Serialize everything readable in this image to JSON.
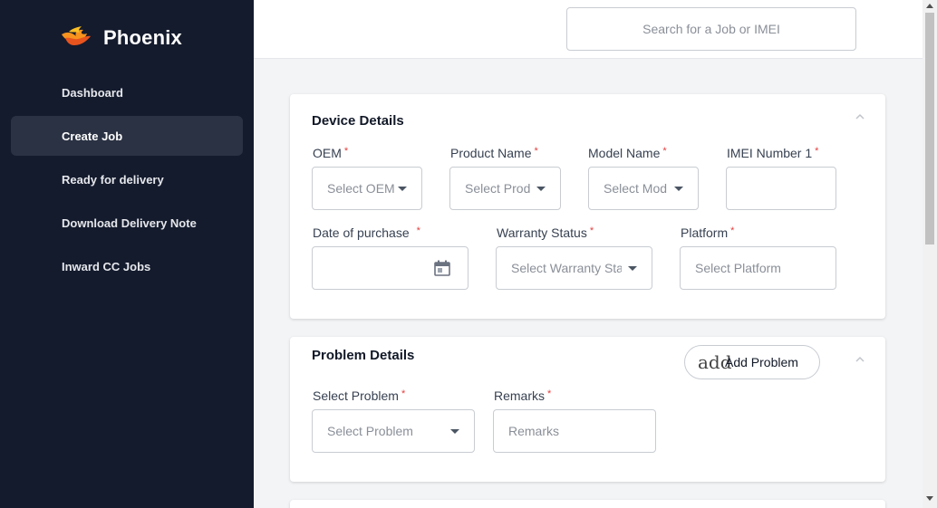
{
  "brand": {
    "name": "Phoenix"
  },
  "sidebar": {
    "items": [
      {
        "label": "Dashboard"
      },
      {
        "label": "Create Job"
      },
      {
        "label": "Ready for delivery"
      },
      {
        "label": "Download Delivery Note"
      },
      {
        "label": "Inward CC Jobs"
      }
    ],
    "active_index": 1
  },
  "header": {
    "search_placeholder": "Search for a Job or IMEI"
  },
  "device_details": {
    "title": "Device Details",
    "required_mark": "*",
    "fields": {
      "oem": {
        "label": "OEM",
        "placeholder": "Select OEM"
      },
      "product_name": {
        "label": "Product Name",
        "placeholder": "Select Prod"
      },
      "model_name": {
        "label": "Model Name",
        "placeholder": "Select Mod"
      },
      "imei": {
        "label": "IMEI Number 1",
        "value": ""
      },
      "date_of_purchase": {
        "label": "Date of purchase",
        "value": ""
      },
      "warranty_status": {
        "label": "Warranty Status",
        "placeholder": "Select Warranty Stat"
      },
      "platform": {
        "label": "Platform",
        "placeholder": "Select Platform"
      }
    }
  },
  "problem_details": {
    "title": "Problem Details",
    "add_button": {
      "icon_text": "add",
      "label": "Add Problem"
    },
    "fields": {
      "problem": {
        "label": "Select Problem",
        "placeholder": "Select Problem"
      },
      "remarks": {
        "label": "Remarks",
        "placeholder": "Remarks"
      }
    }
  },
  "colors": {
    "sidebar_bg": "#141b2d",
    "sidebar_active": "#2b3243",
    "required": "#e53e3e",
    "brand_flame": "#f7931e"
  }
}
